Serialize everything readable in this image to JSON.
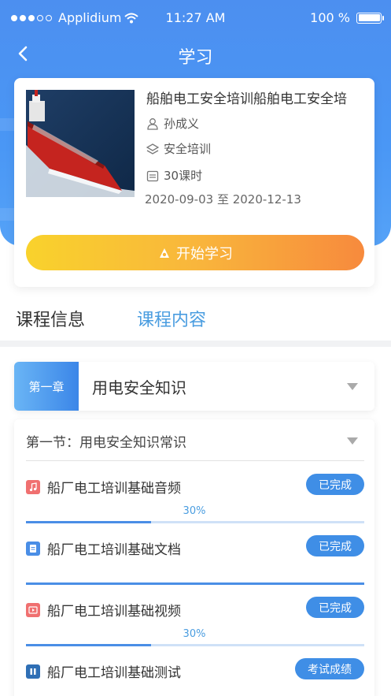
{
  "status_bar": {
    "carrier": "Applidium",
    "time": "11:27 AM",
    "battery": "100 %"
  },
  "nav": {
    "title": "学习"
  },
  "course": {
    "title": "船舶电工安全培训船舶电工安全培",
    "teacher": "孙成义",
    "category": "安全培训",
    "hours": "30课时",
    "date_range": "2020-09-03 至 2020-12-13",
    "start_button": "开始学习"
  },
  "tabs": [
    {
      "label": "课程信息",
      "active": false
    },
    {
      "label": "课程内容",
      "active": true
    }
  ],
  "chapter": {
    "badge": "第一章",
    "title": "用电安全知识"
  },
  "section": {
    "title": "第一节：用电安全知识常识",
    "lessons": [
      {
        "icon": "audio-icon",
        "icon_color": "#f07070",
        "title": "船厂电工培训基础音频",
        "status": "已完成",
        "progress_label": "30%",
        "progress": 0.37
      },
      {
        "icon": "document-icon",
        "icon_color": "#4a8ee6",
        "title": "船厂电工培训基础文档",
        "status": "已完成",
        "progress_label": "",
        "progress": 1.0
      },
      {
        "icon": "video-icon",
        "icon_color": "#f07070",
        "title": "船厂电工培训基础视频",
        "status": "已完成",
        "progress_label": "30%",
        "progress": 0.37
      },
      {
        "icon": "test-icon",
        "icon_color": "#2f6fb5",
        "title": "船厂电工培训基础测试",
        "status": "考试成绩",
        "progress_label": "",
        "progress": null
      }
    ]
  },
  "colors": {
    "primary": "#4a97f5",
    "accent_text": "#4a9de0",
    "button_start": "#f9d22c",
    "button_end": "#f78a3d"
  }
}
